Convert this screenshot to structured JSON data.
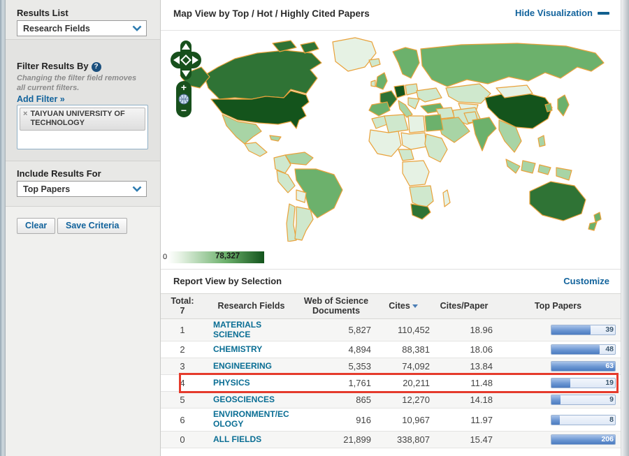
{
  "sidebar": {
    "results_list": {
      "label": "Results List",
      "dropdown_value": "Research Fields"
    },
    "filter": {
      "heading": "Filter Results By",
      "help_icon": "?",
      "note": "Changing the filter field removes all current filters.",
      "add_filter_label": "Add Filter »",
      "active_filter": {
        "remove_icon": "×",
        "label": "TAIYUAN UNIVERSITY OF TECHNOLOGY"
      }
    },
    "include": {
      "heading": "Include Results For",
      "dropdown_value": "Top Papers"
    },
    "buttons": {
      "clear": "Clear",
      "save": "Save Criteria"
    }
  },
  "map_panel": {
    "title": "Map View by Top / Hot / Highly Cited Papers",
    "hide_link": "Hide Visualization",
    "controls": {
      "zoom_in": "+",
      "zoom_out": "−"
    },
    "scale": {
      "min": "0",
      "max": "78,327"
    },
    "palette": {
      "l1": "#e6f2e4",
      "l2": "#cfe8cd",
      "l3": "#a8d4a5",
      "l4": "#6cb16c",
      "l5": "#2f7335",
      "l6": "#14541c"
    },
    "border_color": "#e9a23b",
    "regions": {
      "greenland": "l1",
      "canada": "l5",
      "alaska": "l5",
      "usa": "l6",
      "mexico": "l3",
      "central-america": "l2",
      "caribbean": "l3",
      "venezuela": "l3",
      "colombia": "l2",
      "brazil": "l4",
      "peru": "l2",
      "bolivia": "l1",
      "chile": "l2",
      "argentina": "l2",
      "iceland": "l2",
      "uk": "l4",
      "ireland": "l2",
      "scandinavia": "l4",
      "france": "l5",
      "germany": "l6",
      "poland": "l2",
      "eastern-europe": "l2",
      "balkans": "l2",
      "spain": "l4",
      "italy": "l3",
      "turkey": "l4",
      "russia": "l4",
      "kazakhstan": "l2",
      "central-asia": "l1",
      "iran": "l2",
      "middle-east": "l2",
      "saudi-arabia": "l3",
      "morocco": "l2",
      "algeria": "l2",
      "libya": "l1",
      "egypt": "l4",
      "west-africa": "l1",
      "sahel": "l1",
      "nigeria": "l2",
      "east-africa": "l2",
      "congo": "l1",
      "southern-africa": "l2",
      "south-africa": "l5",
      "madagascar": "l1",
      "india": "l4",
      "pakistan": "l2",
      "china": "l6",
      "mongolia": "l1",
      "korea": "l4",
      "japan": "l4",
      "southeast-asia": "l3",
      "philippines": "l3",
      "indonesia": "l3",
      "new-guinea": "l3",
      "australia": "l5",
      "new-zealand": "l4"
    }
  },
  "report": {
    "title": "Report View by Selection",
    "customize_link": "Customize",
    "table": {
      "rank_header": [
        "Total:",
        "7"
      ],
      "columns": [
        "Research Fields",
        "Web of Science\nDocuments",
        "Cites",
        "Cites/Paper",
        "Top Papers"
      ],
      "sort_column": "Cites",
      "rows": [
        {
          "rank": "1",
          "field": "MATERIALS SCIENCE",
          "wos_documents": "5,827",
          "cites": "110,452",
          "cites_per_paper": "18.96",
          "top_papers": "39",
          "bar_pct": 62,
          "highlighted": false
        },
        {
          "rank": "2",
          "field": "CHEMISTRY",
          "wos_documents": "4,894",
          "cites": "88,381",
          "cites_per_paper": "18.06",
          "top_papers": "48",
          "bar_pct": 76,
          "highlighted": false
        },
        {
          "rank": "3",
          "field": "ENGINEERING",
          "wos_documents": "5,353",
          "cites": "74,092",
          "cites_per_paper": "13.84",
          "top_papers": "63",
          "bar_pct": 100,
          "highlighted": false
        },
        {
          "rank": "4",
          "field": "PHYSICS",
          "wos_documents": "1,761",
          "cites": "20,211",
          "cites_per_paper": "11.48",
          "top_papers": "19",
          "bar_pct": 30,
          "highlighted": true
        },
        {
          "rank": "5",
          "field": "GEOSCIENCES",
          "wos_documents": "865",
          "cites": "12,270",
          "cites_per_paper": "14.18",
          "top_papers": "9",
          "bar_pct": 14,
          "highlighted": false
        },
        {
          "rank": "6",
          "field": "ENVIRONMENT/ECOLOGY",
          "wos_documents": "916",
          "cites": "10,967",
          "cites_per_paper": "11.97",
          "top_papers": "8",
          "bar_pct": 13,
          "highlighted": false
        },
        {
          "rank": "0",
          "field": "ALL FIELDS",
          "wos_documents": "21,899",
          "cites": "338,807",
          "cites_per_paper": "15.47",
          "top_papers": "206",
          "bar_pct": 100,
          "highlighted": false
        }
      ]
    }
  }
}
